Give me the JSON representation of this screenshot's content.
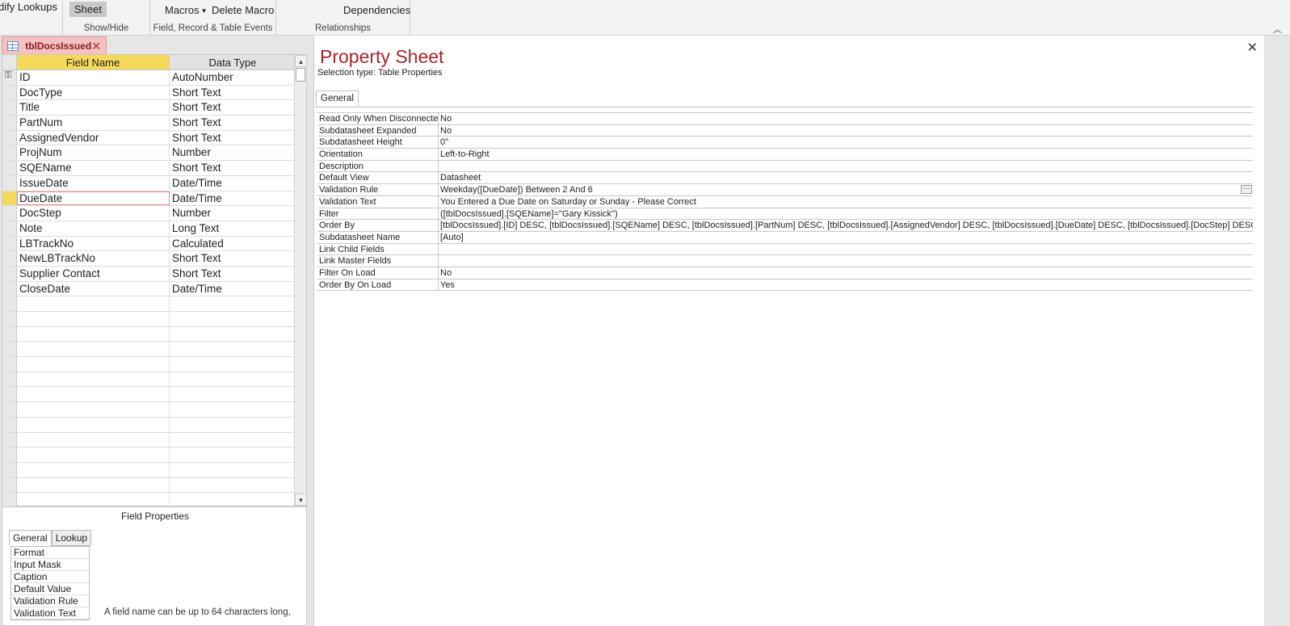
{
  "ribbon": {
    "modify_lookups": "dify Lookups",
    "sheet": "Sheet",
    "show_hide": "Show/Hide",
    "macros": "Macros",
    "delete_macro": "Delete Macro",
    "field_events": "Field, Record & Table Events",
    "dependencies": "Dependencies",
    "relationships": "Relationships"
  },
  "doc_tab": {
    "label": "tblDocsIssued"
  },
  "grid": {
    "col_field": "Field Name",
    "col_type": "Data Type",
    "rows": [
      {
        "name": "ID",
        "type": "AutoNumber"
      },
      {
        "name": "DocType",
        "type": "Short Text"
      },
      {
        "name": "Title",
        "type": "Short Text"
      },
      {
        "name": "PartNum",
        "type": "Short Text"
      },
      {
        "name": "AssignedVendor",
        "type": "Short Text"
      },
      {
        "name": "ProjNum",
        "type": "Number"
      },
      {
        "name": "SQEName",
        "type": "Short Text"
      },
      {
        "name": "IssueDate",
        "type": "Date/Time"
      },
      {
        "name": "DueDate",
        "type": "Date/Time"
      },
      {
        "name": "DocStep",
        "type": "Number"
      },
      {
        "name": "Note",
        "type": "Long Text"
      },
      {
        "name": "LBTrackNo",
        "type": "Calculated"
      },
      {
        "name": "NewLBTrackNo",
        "type": "Short Text"
      },
      {
        "name": "Supplier Contact",
        "type": "Short Text"
      },
      {
        "name": "CloseDate",
        "type": "Date/Time"
      },
      {
        "name": "",
        "type": ""
      },
      {
        "name": "",
        "type": ""
      },
      {
        "name": "",
        "type": ""
      },
      {
        "name": "",
        "type": ""
      },
      {
        "name": "",
        "type": ""
      },
      {
        "name": "",
        "type": ""
      },
      {
        "name": "",
        "type": ""
      },
      {
        "name": "",
        "type": ""
      },
      {
        "name": "",
        "type": ""
      },
      {
        "name": "",
        "type": ""
      },
      {
        "name": "",
        "type": ""
      },
      {
        "name": "",
        "type": ""
      },
      {
        "name": "",
        "type": ""
      },
      {
        "name": "",
        "type": ""
      }
    ]
  },
  "field_properties": {
    "title": "Field Properties",
    "tab_general": "General",
    "tab_lookup": "Lookup",
    "items": [
      "Format",
      "Input Mask",
      "Caption",
      "Default Value",
      "Validation Rule",
      "Validation Text"
    ],
    "hint": "A field name can be up to 64 characters long,"
  },
  "property_sheet": {
    "title": "Property Sheet",
    "selection": "Selection type:  Table Properties",
    "tab": "General",
    "rows": [
      {
        "name": "Read Only When Disconnected",
        "value": "No"
      },
      {
        "name": "Subdatasheet Expanded",
        "value": "No"
      },
      {
        "name": "Subdatasheet Height",
        "value": "0\""
      },
      {
        "name": "Orientation",
        "value": "Left-to-Right"
      },
      {
        "name": "Description",
        "value": ""
      },
      {
        "name": "Default View",
        "value": "Datasheet"
      },
      {
        "name": "Validation Rule",
        "value": "Weekday([DueDate]) Between 2 And 6"
      },
      {
        "name": "Validation Text",
        "value": "You Entered a Due Date on Saturday or Sunday - Please Correct"
      },
      {
        "name": "Filter",
        "value": "([tblDocsIssued].[SQEName]=\"Gary Kissick\")"
      },
      {
        "name": "Order By",
        "value": "[tblDocsIssued].[ID] DESC, [tblDocsIssued].[SQEName] DESC, [tblDocsIssued].[PartNum] DESC, [tblDocsIssued].[AssignedVendor] DESC, [tblDocsIssued].[DueDate] DESC, [tblDocsIssued].[DocStep] DESC, [tbl"
      },
      {
        "name": "Subdatasheet Name",
        "value": "[Auto]"
      },
      {
        "name": "Link Child Fields",
        "value": ""
      },
      {
        "name": "Link Master Fields",
        "value": ""
      },
      {
        "name": "Filter On Load",
        "value": "No"
      },
      {
        "name": "Order By On Load",
        "value": "Yes"
      }
    ]
  }
}
